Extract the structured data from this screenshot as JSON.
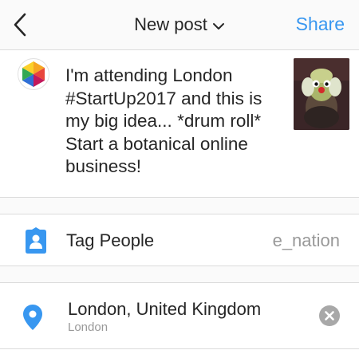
{
  "header": {
    "title": "New post",
    "share_label": "Share",
    "back_icon": "chevron-left-icon",
    "title_dropdown_icon": "chevron-down-icon",
    "accent_color": "#3897f0"
  },
  "post": {
    "caption": "I'm attending London\n#StartUp2017 and this is\nmy big idea... *drum roll*\nStart a botanical online\nbusiness!",
    "avatar_icon": "hexagon-logo-icon",
    "thumbnail": "post-thumbnail-image"
  },
  "tag_people": {
    "label": "Tag People",
    "value": "e_nation",
    "icon": "person-tag-icon"
  },
  "location": {
    "title": "London, United Kingdom",
    "subtitle": "London",
    "icon": "location-pin-icon",
    "clear_icon": "clear-circle-icon"
  }
}
